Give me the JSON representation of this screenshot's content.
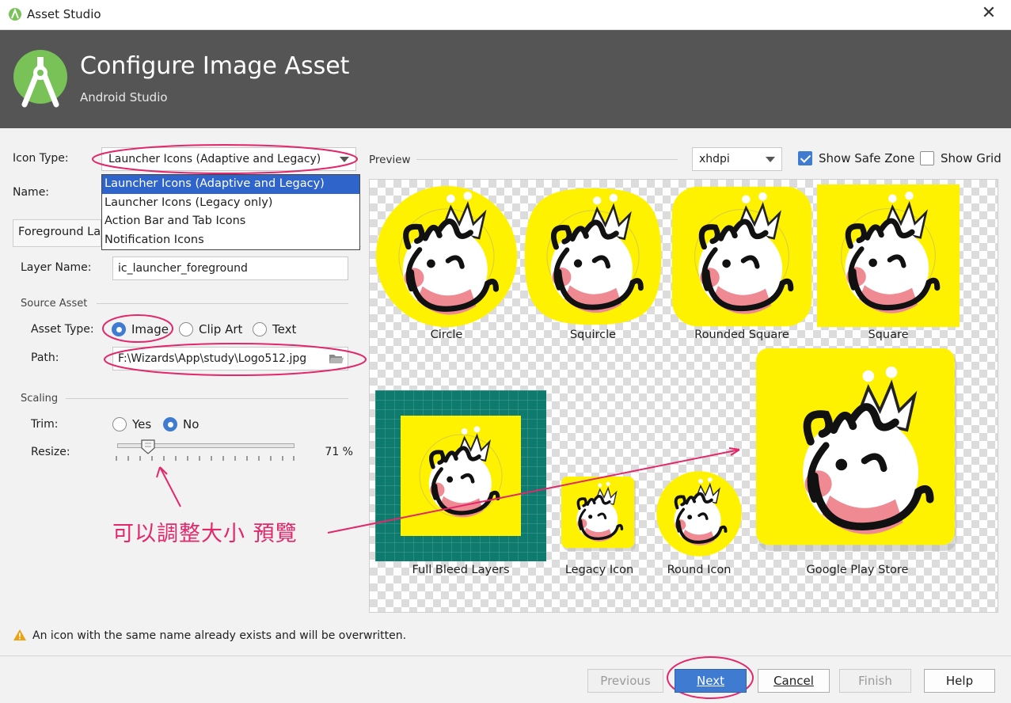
{
  "window": {
    "title": "Asset Studio",
    "close_glyph": "✕"
  },
  "header": {
    "title": "Configure Image Asset",
    "subtitle": "Android Studio"
  },
  "icon_type": {
    "label": "Icon Type:",
    "selected": "Launcher Icons (Adaptive and Legacy)",
    "options": [
      "Launcher Icons (Adaptive and Legacy)",
      "Launcher Icons (Legacy only)",
      "Action Bar and Tab Icons",
      "Notification Icons"
    ]
  },
  "name": {
    "label": "Name:"
  },
  "tabs": {
    "foreground": "Foreground Lay"
  },
  "layer": {
    "label": "Layer Name:",
    "value": "ic_launcher_foreground"
  },
  "source_asset": {
    "section": "Source Asset",
    "asset_type_label": "Asset Type:",
    "options": [
      "Image",
      "Clip Art",
      "Text"
    ],
    "selected": "Image",
    "path_label": "Path:",
    "path_value": "F:\\Wizards\\App\\study\\Logo512.jpg"
  },
  "scaling": {
    "section": "Scaling",
    "trim_label": "Trim:",
    "trim_options": [
      "Yes",
      "No"
    ],
    "trim_selected": "No",
    "resize_label": "Resize:",
    "resize_value": "71 %",
    "resize_fraction": 0.71
  },
  "preview": {
    "label": "Preview",
    "density": "xhdpi",
    "show_safe_zone": "Show Safe Zone",
    "show_safe_zone_checked": true,
    "show_grid": "Show Grid",
    "show_grid_checked": false,
    "captions": {
      "circle": "Circle",
      "squircle": "Squircle",
      "rounded_square": "Rounded Square",
      "square": "Square",
      "full_bleed": "Full Bleed Layers",
      "legacy": "Legacy Icon",
      "round": "Round Icon",
      "play_store": "Google Play Store"
    }
  },
  "annotation": {
    "text": "可以調整大小 預覽"
  },
  "warning": {
    "text": "An icon with the same name already exists and will be overwritten."
  },
  "buttons": {
    "previous": "Previous",
    "next": "Next",
    "cancel": "Cancel",
    "finish": "Finish",
    "help": "Help"
  },
  "colors": {
    "accent": "#3f7bd1",
    "header": "#555555",
    "icon_yellow": "#fff200",
    "android_green": "#78c257",
    "full_bleed_teal": "#0f7a6e",
    "annotation": "#e2276b"
  }
}
